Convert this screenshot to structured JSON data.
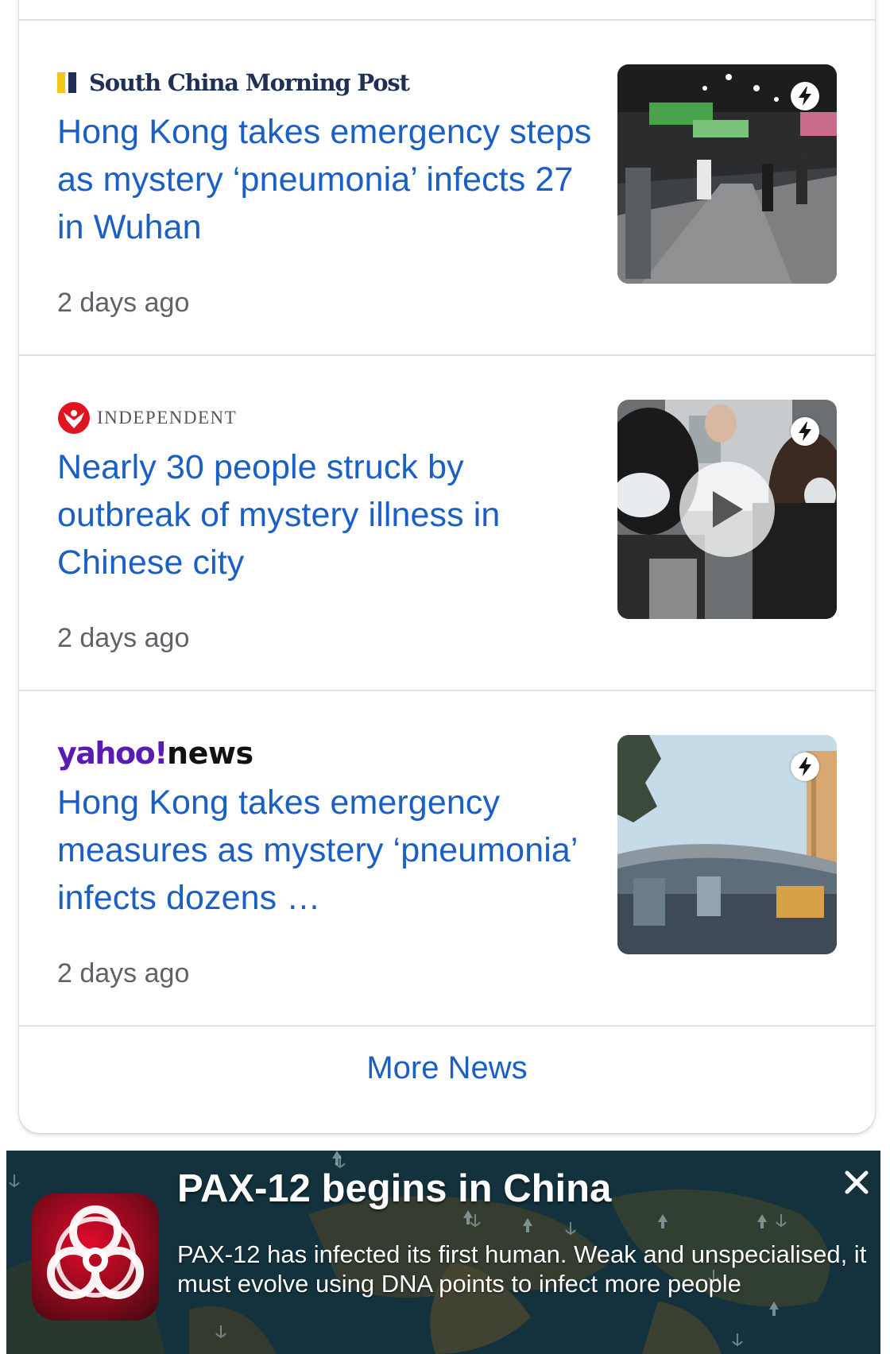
{
  "articles": [
    {
      "source": "South China Morning Post",
      "headline": "Hong Kong takes emergency steps as mystery ‘pneumonia’ infects 27 in Wuhan",
      "time": "2 days ago",
      "thumb_icon": "amp-lightning-icon"
    },
    {
      "source": "INDEPENDENT",
      "headline": "Nearly 30 people struck by outbreak of mystery illness in Chinese city",
      "time": "2 days ago",
      "thumb_icon": "amp-lightning-icon",
      "video": true
    },
    {
      "source_brand": "yahoo!",
      "source_suffix": "news",
      "headline": "Hong Kong takes emergency measures as mystery ‘pneumonia’ infects dozens …",
      "time": "2 days ago",
      "thumb_icon": "amp-lightning-icon"
    }
  ],
  "more_news": "More News",
  "notification": {
    "title": "PAX-12 begins in China",
    "body": "PAX-12 has infected its first human. Weak and unspecialised, it must evolve using DNA points to infect more people",
    "app_icon": "biohazard-icon",
    "close_icon": "close-icon"
  },
  "colors": {
    "link": "#1a5fc6",
    "meta": "#5f6368",
    "yahoo": "#5a1bb5",
    "banner_bg": "#12333f",
    "app_red": "#e10b2a"
  }
}
